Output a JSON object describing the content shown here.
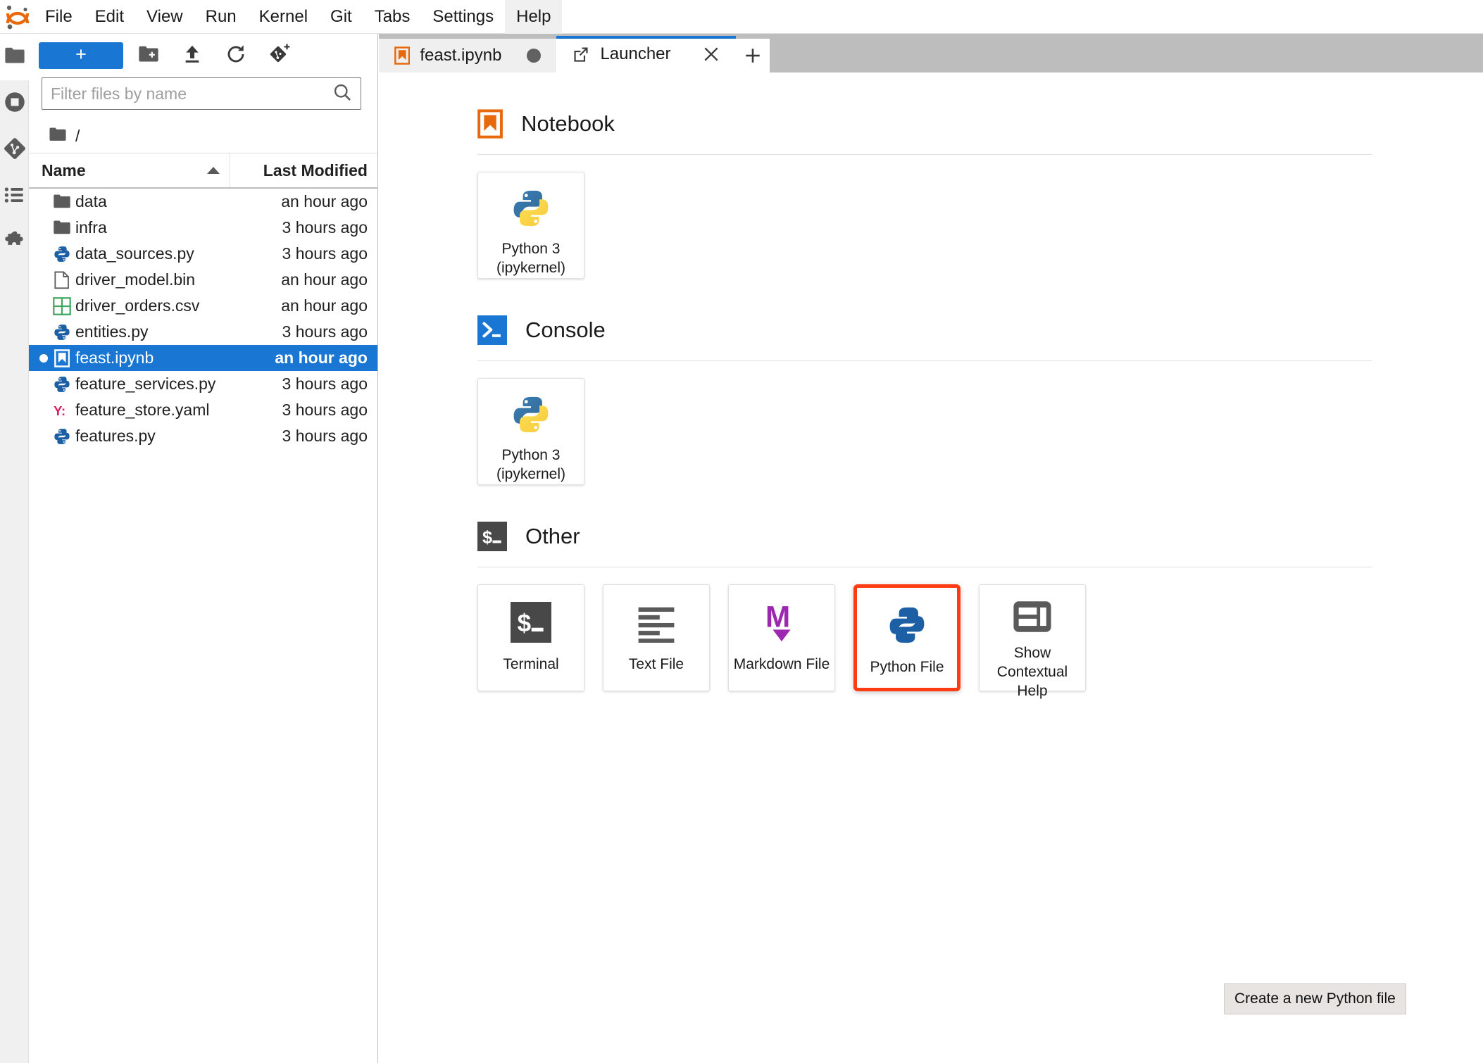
{
  "app": {
    "logo_icon": "jupyter-logo"
  },
  "menubar": {
    "items": [
      {
        "label": "File",
        "active": false
      },
      {
        "label": "Edit",
        "active": false
      },
      {
        "label": "View",
        "active": false
      },
      {
        "label": "Run",
        "active": false
      },
      {
        "label": "Kernel",
        "active": false
      },
      {
        "label": "Git",
        "active": false
      },
      {
        "label": "Tabs",
        "active": false
      },
      {
        "label": "Settings",
        "active": false
      },
      {
        "label": "Help",
        "active": true
      }
    ]
  },
  "activitybar": {
    "items": [
      {
        "icon": "folder-icon",
        "name": "file-browser",
        "selected": true
      },
      {
        "icon": "running-sessions-icon",
        "name": "running-terminals-and-kernels",
        "selected": false
      },
      {
        "icon": "git-icon",
        "name": "git-panel",
        "selected": false
      },
      {
        "icon": "table-of-contents-icon",
        "name": "table-of-contents",
        "selected": false
      },
      {
        "icon": "puzzle-icon",
        "name": "extension-manager",
        "selected": false
      }
    ]
  },
  "filebrowser": {
    "toolbar": {
      "new_label": "+",
      "new_folder_icon": "new-folder-icon",
      "upload_icon": "upload-icon",
      "refresh_icon": "refresh-icon",
      "git_clone_icon": "new-git-repository-icon"
    },
    "filter": {
      "placeholder": "Filter files by name",
      "value": "",
      "search_icon": "search-icon"
    },
    "breadcrumb": {
      "root_icon": "folder-icon",
      "path": "/"
    },
    "columns": {
      "name": "Name",
      "last_modified": "Last Modified",
      "sort_direction": "ascending"
    },
    "files": [
      {
        "name": "data",
        "modified": "an hour ago",
        "icon": "folder-icon",
        "selected": false,
        "running": false
      },
      {
        "name": "infra",
        "modified": "3 hours ago",
        "icon": "folder-icon",
        "selected": false,
        "running": false
      },
      {
        "name": "data_sources.py",
        "modified": "3 hours ago",
        "icon": "python-icon",
        "selected": false,
        "running": false
      },
      {
        "name": "driver_model.bin",
        "modified": "an hour ago",
        "icon": "file-icon",
        "selected": false,
        "running": false
      },
      {
        "name": "driver_orders.csv",
        "modified": "an hour ago",
        "icon": "spreadsheet-icon",
        "selected": false,
        "running": false
      },
      {
        "name": "entities.py",
        "modified": "3 hours ago",
        "icon": "python-icon",
        "selected": false,
        "running": false
      },
      {
        "name": "feast.ipynb",
        "modified": "an hour ago",
        "icon": "notebook-icon",
        "selected": true,
        "running": true
      },
      {
        "name": "feature_services.py",
        "modified": "3 hours ago",
        "icon": "python-icon",
        "selected": false,
        "running": false
      },
      {
        "name": "feature_store.yaml",
        "modified": "3 hours ago",
        "icon": "yaml-icon",
        "selected": false,
        "running": false
      },
      {
        "name": "features.py",
        "modified": "3 hours ago",
        "icon": "python-icon",
        "selected": false,
        "running": false
      }
    ]
  },
  "tabs": {
    "items": [
      {
        "label": "feast.ipynb",
        "icon": "notebook-icon",
        "active": false,
        "dirty": true
      },
      {
        "label": "Launcher",
        "icon": "launcher-icon",
        "active": true,
        "dirty": false
      }
    ],
    "new_tab_icon": "plus-icon"
  },
  "launcher": {
    "sections": [
      {
        "title": "Notebook",
        "icon": "notebook-icon",
        "cards": [
          {
            "label": "Python 3\n(ipykernel)",
            "icon": "python-color-icon",
            "highlighted": false
          }
        ]
      },
      {
        "title": "Console",
        "icon": "console-icon",
        "cards": [
          {
            "label": "Python 3\n(ipykernel)",
            "icon": "python-color-icon",
            "highlighted": false
          }
        ]
      },
      {
        "title": "Other",
        "icon": "terminal-icon",
        "cards": [
          {
            "label": "Terminal",
            "icon": "terminal-icon",
            "highlighted": false
          },
          {
            "label": "Text File",
            "icon": "text-file-icon",
            "highlighted": false
          },
          {
            "label": "Markdown File",
            "icon": "markdown-icon",
            "highlighted": false
          },
          {
            "label": "Python File",
            "icon": "python-mono-icon",
            "highlighted": true
          },
          {
            "label": "Show\nContextual Help",
            "icon": "contextual-help-icon",
            "highlighted": false
          }
        ]
      }
    ],
    "tooltip": {
      "text": "Create a new Python file"
    }
  },
  "colors": {
    "accent_blue": "#1976d2",
    "highlight_red": "#ff3b14",
    "jupyter_orange": "#e8690b",
    "python_blue": "#2b5b84",
    "python_yellow": "#f5d04f",
    "markdown_purple": "#9c27b0",
    "csv_green": "#41a85f",
    "yaml_crimson": "#d81b60"
  }
}
